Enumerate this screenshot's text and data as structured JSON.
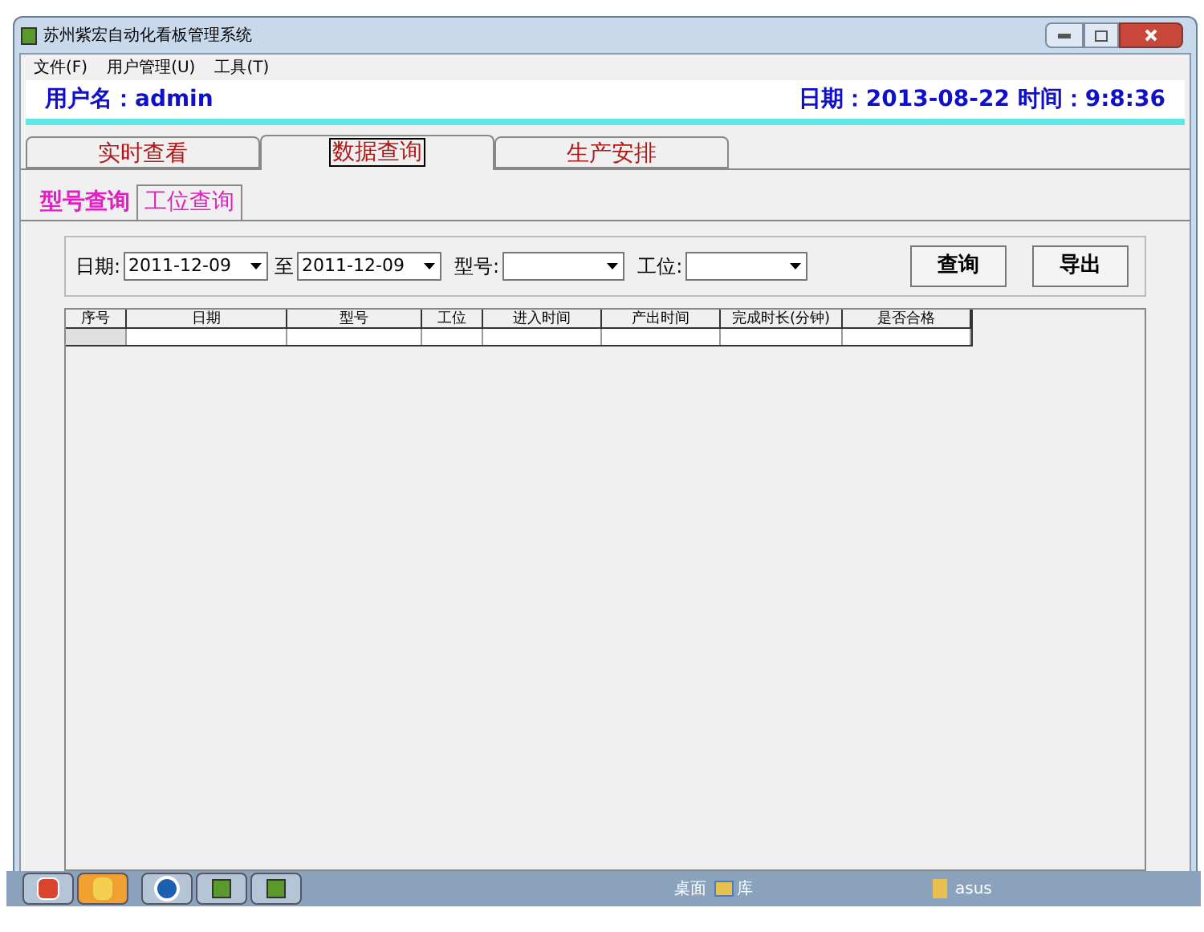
{
  "window": {
    "title": "苏州紫宏自动化看板管理系统"
  },
  "menu": [
    {
      "label": "文件(F)"
    },
    {
      "label": "用户管理(U)"
    },
    {
      "label": "工具(T)"
    }
  ],
  "header": {
    "user": "用户名：admin",
    "datetime": "日期：2013-08-22 时间：9:8:36"
  },
  "tabs": [
    {
      "label": "实时查看",
      "selected": false
    },
    {
      "label": "数据查询",
      "selected": true
    },
    {
      "label": "生产安排",
      "selected": false
    }
  ],
  "subtabs": [
    {
      "label": "型号查询",
      "selected": true
    },
    {
      "label": "工位查询",
      "selected": false
    }
  ],
  "filters": [
    {
      "label": "日期:",
      "value": "2011-12-09"
    },
    {
      "label": "至",
      "value": "2011-12-09"
    },
    {
      "label": "型号:"
    },
    {
      "label": "工位:"
    }
  ],
  "buttons": [
    "查询",
    "导出"
  ],
  "table": {
    "columns": [
      "序号",
      "日期",
      "型号",
      "工位",
      "进入时间",
      "产出时间",
      "完成时长(分钟)",
      "是否合格"
    ]
  },
  "taskbar": {
    "apps": [
      {
        "kind": "red",
        "active": false
      },
      {
        "kind": "orange",
        "active": true
      },
      {
        "kind": "globe",
        "active": false
      },
      {
        "kind": "book",
        "active": false
      },
      {
        "kind": "book",
        "active": false
      }
    ],
    "desktop": "桌面",
    "library": "库",
    "user": "asus"
  }
}
